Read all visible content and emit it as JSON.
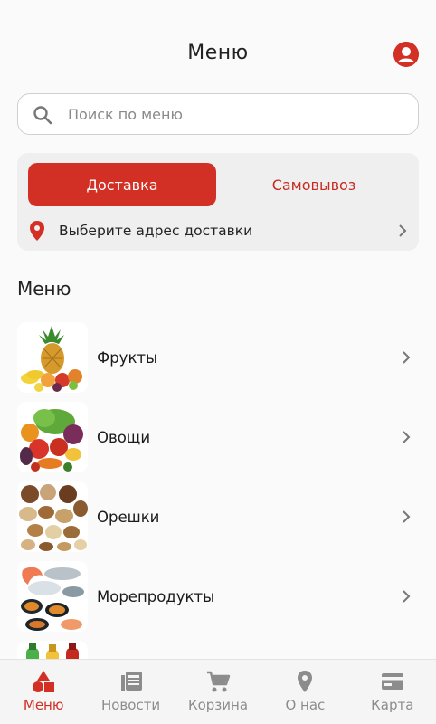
{
  "header": {
    "title": "Меню",
    "profile_icon": "account-circle-icon"
  },
  "search": {
    "placeholder": "Поиск по меню",
    "value": "",
    "icon": "search-icon"
  },
  "delivery": {
    "tabs": [
      {
        "label": "Доставка",
        "active": true
      },
      {
        "label": "Самовывоз",
        "active": false
      }
    ],
    "address_prompt": "Выберите адрес доставки",
    "pin_icon": "location-pin-icon"
  },
  "menu_section": {
    "title": "Меню",
    "items": [
      {
        "label": "Фрукты",
        "image": "fruits-image"
      },
      {
        "label": "Овощи",
        "image": "vegetables-image"
      },
      {
        "label": "Орешки",
        "image": "nuts-image"
      },
      {
        "label": "Морепродукты",
        "image": "seafood-image"
      },
      {
        "label": "",
        "image": "drinks-image"
      }
    ]
  },
  "bottom_nav": {
    "items": [
      {
        "label": "Меню",
        "icon": "shapes-icon",
        "active": true
      },
      {
        "label": "Новости",
        "icon": "news-icon",
        "active": false
      },
      {
        "label": "Корзина",
        "icon": "cart-icon",
        "active": false
      },
      {
        "label": "О нас",
        "icon": "location-pin-icon",
        "active": false
      },
      {
        "label": "Карта",
        "icon": "credit-card-icon",
        "active": false
      }
    ]
  },
  "colors": {
    "accent": "#d23025",
    "inactive": "#8c8c8c",
    "background": "#fafafa",
    "card": "#efefef"
  }
}
